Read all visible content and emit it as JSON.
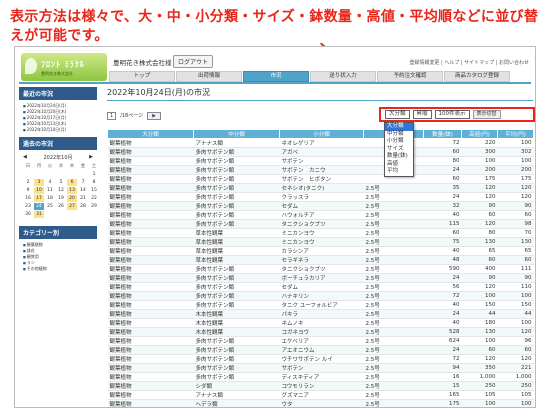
{
  "annotation": {
    "text": "表示方法は様々で、大・中・小分類・サイズ・鉢数量・高値・平均順などに並び替えが可能です。",
    "color": "#e8261b"
  },
  "header": {
    "logo_main": "ﾌﾛﾝﾄ ﾐﾗｸﾙ",
    "logo_sub": "豊明花き株式会社",
    "company": "豊明花き株式会社様",
    "logout": "ログアウト",
    "links": "登録情報変更 | ヘルプ | サイトマップ | お問い合わせ"
  },
  "tabs": [
    {
      "label": "トップ",
      "active": false
    },
    {
      "label": "出荷情報",
      "active": false
    },
    {
      "label": "市況",
      "active": true
    },
    {
      "label": "送り状入力",
      "active": false
    },
    {
      "label": "予約注文確認",
      "active": false
    },
    {
      "label": "商品カタログ登録",
      "active": false
    }
  ],
  "sidebar": {
    "recent_title": "最近の市況",
    "recent_items": [
      "2022年10月24日(月)",
      "2022年10月20日(木)",
      "2022年10月17日(月)",
      "2022年10月13日(木)",
      "2022年10月10日(月)"
    ],
    "calendar_title": "過去の市況",
    "calendar_month": "2022年10月",
    "calendar_prev": "◀",
    "calendar_next": "▶",
    "weekdays": [
      "日",
      "月",
      "火",
      "水",
      "木",
      "金",
      "土"
    ],
    "days": [
      "",
      "",
      "",
      "",
      "",
      "",
      "1",
      "2",
      "3",
      "4",
      "5",
      "6",
      "7",
      "8",
      "9",
      "10",
      "11",
      "12",
      "13",
      "14",
      "15",
      "16",
      "17",
      "18",
      "19",
      "20",
      "21",
      "22",
      "23",
      "24",
      "25",
      "26",
      "27",
      "28",
      "29",
      "30",
      "31",
      "",
      "",
      "",
      ""
    ],
    "category_title": "カテゴリー別",
    "category_items": [
      "観葉植物",
      "鉢花",
      "観賞用",
      "ラン",
      "その他植物"
    ]
  },
  "main": {
    "title": "2022年10月24日(月)の市況",
    "page_value": "1",
    "page_total": "/18ページ",
    "next": "▶",
    "sort_select": "大分類",
    "order_select": "昇順",
    "count_select": "100件表示",
    "sort_button": "表示切替",
    "dropdown_options": [
      "大分類",
      "中分類",
      "小分類",
      "サイズ",
      "数量(鉢)",
      "高値",
      "平均"
    ],
    "dropdown_selected": 0
  },
  "table": {
    "headers": [
      "大分類",
      "中分類",
      "小分類",
      "サイズ",
      "数量(鉢)",
      "高値(円)",
      "平均(円)"
    ],
    "rows": [
      [
        "観葉植物",
        "アナナス類",
        "ネオレゲリア",
        "",
        "72",
        "220",
        "100"
      ],
      [
        "観葉植物",
        "多肉サボテン類",
        "アガベ",
        "",
        "60",
        "300",
        "302"
      ],
      [
        "観葉植物",
        "多肉サボテン類",
        "サボテン",
        "",
        "80",
        "100",
        "100"
      ],
      [
        "観葉植物",
        "多肉サボテン類",
        "サボテン　カニウ",
        "",
        "24",
        "200",
        "200"
      ],
      [
        "観葉植物",
        "多肉サボテン類",
        "サボテン　ヒボタン",
        "",
        "60",
        "175",
        "175"
      ],
      [
        "観葉植物",
        "多肉サボテン類",
        "セネシオ(タニク)",
        "2.5号",
        "35",
        "120",
        "120"
      ],
      [
        "観葉植物",
        "多肉サボテン類",
        "クラッスラ",
        "2.5号",
        "24",
        "120",
        "120"
      ],
      [
        "観葉植物",
        "多肉サボテン類",
        "セダム",
        "2.5号",
        "32",
        "90",
        "90"
      ],
      [
        "観葉植物",
        "多肉サボテン類",
        "ハウォルチア",
        "2.5号",
        "40",
        "60",
        "60"
      ],
      [
        "観葉植物",
        "多肉サボテン類",
        "タニクショクブツ",
        "2.5号",
        "115",
        "120",
        "98"
      ],
      [
        "観葉植物",
        "草本性観葉",
        "ミニカンヨウ",
        "2.5号",
        "60",
        "80",
        "70"
      ],
      [
        "観葉植物",
        "草本性観葉",
        "ミニカンヨウ",
        "2.5号",
        "75",
        "130",
        "130"
      ],
      [
        "観葉植物",
        "草本性観葉",
        "カラシンア",
        "2.5号",
        "40",
        "65",
        "65"
      ],
      [
        "観葉植物",
        "草本性観葉",
        "セラギネラ",
        "2.5号",
        "48",
        "60",
        "60"
      ],
      [
        "観葉植物",
        "多肉サボテン類",
        "タニクショクブツ",
        "2.5号",
        "590",
        "400",
        "111"
      ],
      [
        "観葉植物",
        "多肉サボテン類",
        "ボーチュラカリア",
        "2.5号",
        "24",
        "90",
        "90"
      ],
      [
        "観葉植物",
        "多肉サボテン類",
        "セダム",
        "2.5号",
        "56",
        "120",
        "110"
      ],
      [
        "観葉植物",
        "多肉サボテン類",
        "ハナキリン",
        "2.5号",
        "72",
        "100",
        "100"
      ],
      [
        "観葉植物",
        "多肉サボテン類",
        "タニク ユーフォルビア",
        "2.5号",
        "40",
        "150",
        "150"
      ],
      [
        "観葉植物",
        "木本性観葉",
        "パキラ",
        "2.5号",
        "24",
        "44",
        "44"
      ],
      [
        "観葉植物",
        "木本性観葉",
        "ネムノキ",
        "2.5号",
        "40",
        "180",
        "100"
      ],
      [
        "観葉植物",
        "木本性観葉",
        "コガネヨウ",
        "2.5号",
        "528",
        "130",
        "120"
      ],
      [
        "観葉植物",
        "多肉サボテン類",
        "エケベリア",
        "2.5号",
        "624",
        "100",
        "96"
      ],
      [
        "観葉植物",
        "多肉サボテン類",
        "アエオニウム",
        "2.5号",
        "24",
        "60",
        "60"
      ],
      [
        "観葉植物",
        "多肉サボテン類",
        "ウチワサボテン ルイ",
        "2.5号",
        "72",
        "120",
        "120"
      ],
      [
        "観葉植物",
        "多肉サボテン類",
        "サボテン",
        "2.5号",
        "94",
        "350",
        "221"
      ],
      [
        "観葉植物",
        "多肉サボテン類",
        "ディスキディア",
        "2.5号",
        "16",
        "1,000",
        "1,000"
      ],
      [
        "観葉植物",
        "シダ類",
        "コウモリラン",
        "2.5号",
        "15",
        "250",
        "250"
      ],
      [
        "観葉植物",
        "アナナス類",
        "グズマニア",
        "2.5号",
        "165",
        "105",
        "105"
      ],
      [
        "観葉植物",
        "ヘデラ類",
        "ウタ",
        "2.5号",
        "175",
        "100",
        "100"
      ]
    ]
  }
}
